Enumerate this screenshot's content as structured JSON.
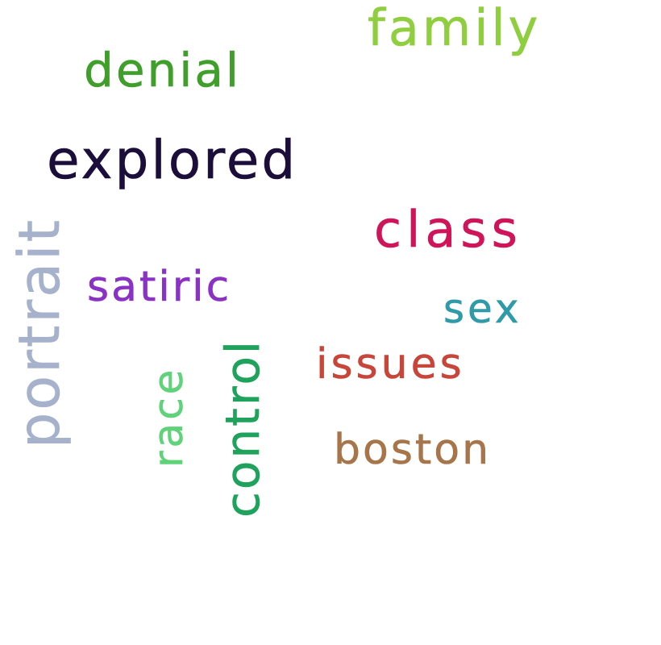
{
  "cloud": {
    "words": {
      "family": {
        "text": "family",
        "color": "#8fce3e"
      },
      "denial": {
        "text": "denial",
        "color": "#3f9f2a"
      },
      "explored": {
        "text": "explored",
        "color": "#1c0e3a"
      },
      "class": {
        "text": "class",
        "color": "#d0145a"
      },
      "satiric": {
        "text": "satiric",
        "color": "#8a32c4"
      },
      "sex": {
        "text": "sex",
        "color": "#2f9aa8"
      },
      "issues": {
        "text": "issues",
        "color": "#c8453a"
      },
      "boston": {
        "text": "boston",
        "color": "#a7754a"
      },
      "portrait": {
        "text": "portrait",
        "color": "#a6b2cc"
      },
      "race": {
        "text": "race",
        "color": "#5fd27a"
      },
      "control": {
        "text": "control",
        "color": "#1fa35c"
      }
    }
  }
}
